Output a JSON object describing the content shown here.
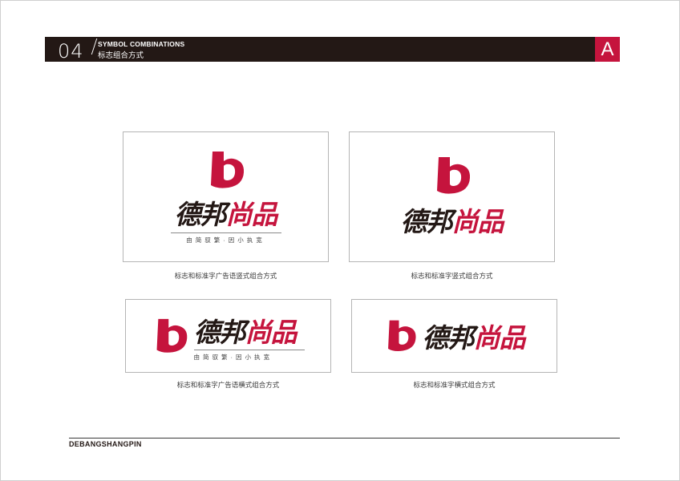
{
  "header": {
    "section_number": "04",
    "title_en": "SYMBOL COMBINATIONS",
    "title_cn": "标志组合方式",
    "section_letter": "A"
  },
  "brand": {
    "wordmark_part1": "德邦",
    "wordmark_part2": "尚品",
    "tagline": "由简驭繁·因小执宽",
    "colors": {
      "red": "#c5143d",
      "dark": "#231815"
    }
  },
  "panels": [
    {
      "caption": "标志和标准字广告语竖式组合方式"
    },
    {
      "caption": "标志和标准字竖式组合方式"
    },
    {
      "caption": "标志和标准字广告语横式组合方式"
    },
    {
      "caption": "标志和标准字横式组合方式"
    }
  ],
  "footer": {
    "brand_name": "DEBANGSHANGPIN"
  }
}
